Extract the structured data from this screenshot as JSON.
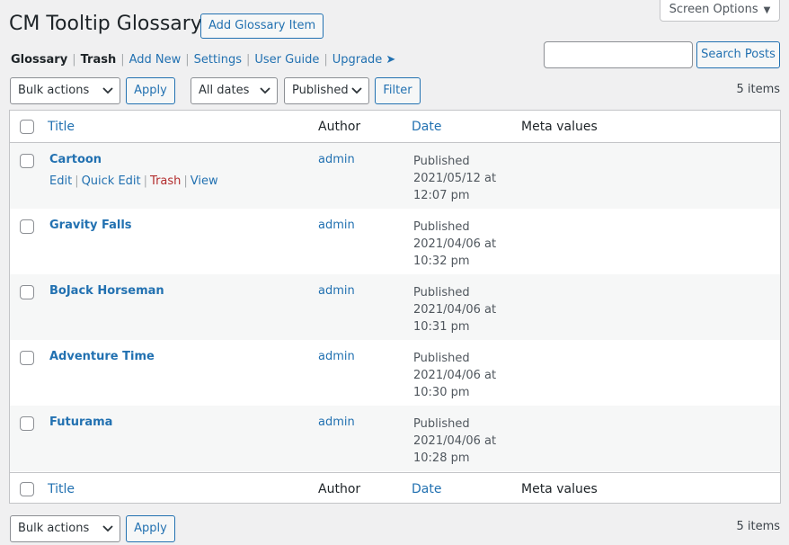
{
  "header": {
    "title": "CM Tooltip Glossary",
    "add_button": "Add Glossary Item",
    "screen_options": "Screen Options"
  },
  "subnav": [
    {
      "label": "Glossary",
      "current": true
    },
    {
      "label": "Trash",
      "current": true
    },
    {
      "label": "Add New"
    },
    {
      "label": "Settings"
    },
    {
      "label": "User Guide"
    },
    {
      "label": "Upgrade ➤"
    }
  ],
  "search": {
    "value": "",
    "button": "Search Posts"
  },
  "toolbar_top": {
    "bulk": "Bulk actions",
    "apply": "Apply",
    "dates": "All dates",
    "status": "Published",
    "filter": "Filter",
    "count": "5 items"
  },
  "table": {
    "columns": [
      "Title",
      "Author",
      "Date",
      "Meta values"
    ],
    "rows": [
      {
        "title": "Cartoon",
        "author": "admin",
        "status": "Published",
        "date": "2021/05/12 at",
        "time": "12:07 pm",
        "actions": [
          "Edit",
          "Quick Edit",
          "Trash",
          "View"
        ]
      },
      {
        "title": "Gravity Falls",
        "author": "admin",
        "status": "Published",
        "date": "2021/04/06 at",
        "time": "10:32 pm"
      },
      {
        "title": "BoJack Horseman",
        "author": "admin",
        "status": "Published",
        "date": "2021/04/06 at",
        "time": "10:31 pm"
      },
      {
        "title": "Adventure Time",
        "author": "admin",
        "status": "Published",
        "date": "2021/04/06 at",
        "time": "10:30 pm"
      },
      {
        "title": "Futurama",
        "author": "admin",
        "status": "Published",
        "date": "2021/04/06 at",
        "time": "10:28 pm"
      }
    ]
  },
  "toolbar_bottom": {
    "bulk": "Bulk actions",
    "apply": "Apply",
    "count": "5 items"
  },
  "colors": {
    "link": "#2271b1",
    "trash": "#b32d2e",
    "background": "#f0f0f1"
  },
  "icons": {
    "dropdown": "chevron-down-icon",
    "screen_options_arrow": "triangle-down-icon"
  }
}
